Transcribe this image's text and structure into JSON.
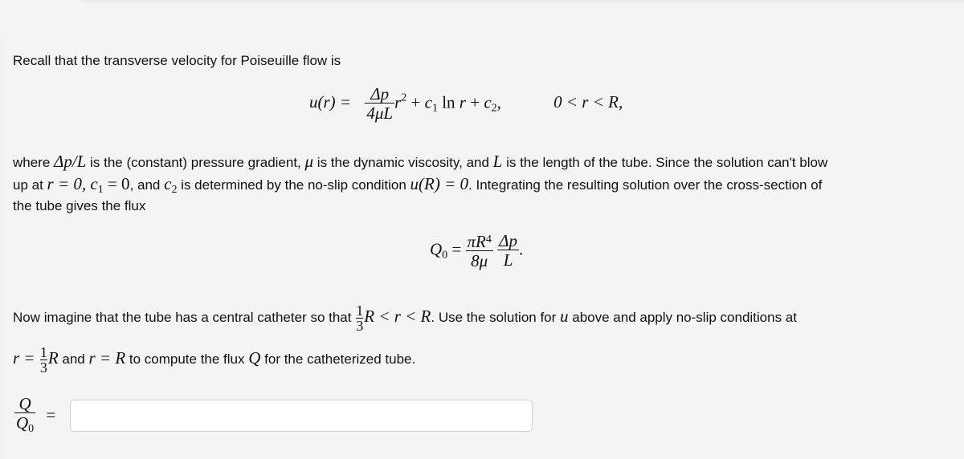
{
  "intro": {
    "text": "Recall that the transverse velocity for Poiseuille flow is"
  },
  "velocity_equation": {
    "lhs": "u(r) =",
    "frac_num": "Δp",
    "frac_den": "4μL",
    "term_r": "r",
    "r_exp": "2",
    "plus1": " + ",
    "c1": "c",
    "c1_sub": "1",
    "ln": " ln ",
    "r2": "r",
    "plus2": " + ",
    "c2": "c",
    "c2_sub": "2",
    "comma": ",",
    "domain": "0 < r < R,"
  },
  "paragraph2": {
    "line1_a": "where ",
    "line1_dp": "Δp/L",
    "line1_b": " is the (constant) pressure gradient, ",
    "line1_mu": "μ",
    "line1_c": " is the dynamic viscosity, and ",
    "line1_L": "L",
    "line1_d": " is the length of the tube. Since the solution can't blow",
    "line2_a": "up at ",
    "line2_r0": "r = 0, ",
    "line2_c1": "c",
    "line2_c1_sub": "1",
    "line2_eq0": " = 0",
    "line2_b": ", and ",
    "line2_c2": "c",
    "line2_c2_sub": "2",
    "line2_c": " is determined by the no-slip condition ",
    "line2_uR": "u(R) = 0",
    "line2_d": ". Integrating the resulting solution over the cross-section of",
    "line3": "the tube gives the flux"
  },
  "flux_equation": {
    "lhs": "Q",
    "lhs_sub": "0",
    "equals": " = ",
    "frac1_num": "πR",
    "frac1_num_exp": "4",
    "frac1_den": "8μ",
    "frac2_num": "Δp",
    "frac2_den": "L",
    "period": "."
  },
  "paragraph3": {
    "line1_a": "Now imagine that the tube has a central catheter so that ",
    "frac_num": "1",
    "frac_den": "3",
    "line1_ineq": "R < r < R",
    "line1_b": ". Use the solution for ",
    "line1_u": "u",
    "line1_c": " above and apply no-slip conditions at",
    "line2_r": "r = ",
    "line2_frac_num": "1",
    "line2_frac_den": "3",
    "line2_R": "R",
    "line2_a": " and ",
    "line2_rR": "r = R",
    "line2_b": " to compute the flux ",
    "line2_Q": "Q",
    "line2_c": " for the catheterized tube."
  },
  "answer": {
    "lhs_num": "Q",
    "lhs_den": "Q",
    "lhs_den_sub": "0",
    "equals": "=",
    "input_value": "",
    "input_placeholder": ""
  }
}
